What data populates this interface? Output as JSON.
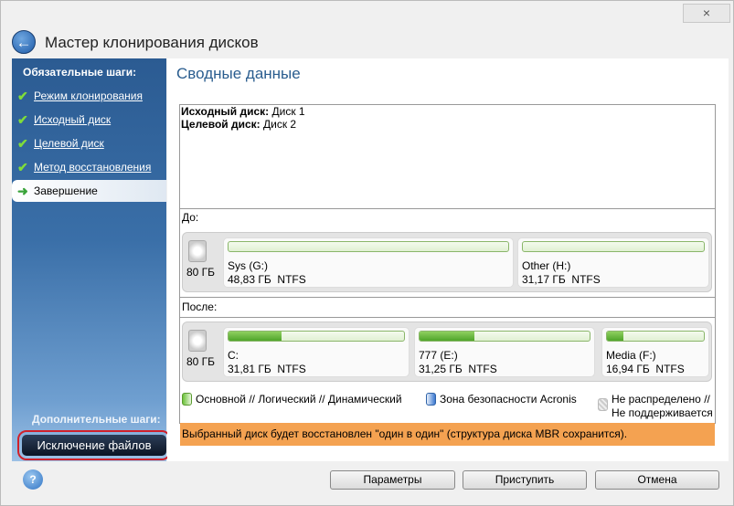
{
  "window": {
    "close_icon": "×",
    "title": "Мастер клонирования дисков"
  },
  "sidebar": {
    "required_heading": "Обязательные шаги:",
    "items": [
      {
        "label": "Режим клонирования",
        "done": true
      },
      {
        "label": "Исходный диск",
        "done": true
      },
      {
        "label": "Целевой диск",
        "done": true
      },
      {
        "label": "Метод восстановления",
        "done": true
      },
      {
        "label": "Завершение",
        "current": true
      }
    ],
    "optional_heading": "Дополнительные шаги:",
    "exclude_button": "Исключение файлов"
  },
  "main": {
    "title": "Сводные данные",
    "source_label": "Исходный диск:",
    "source_value": " Диск 1",
    "target_label": "Целевой диск:",
    "target_value": " Диск 2",
    "before_label": "До:",
    "after_label": "После:",
    "before": {
      "disk_size": "80 ГБ",
      "partitions": [
        {
          "name": "Sys (G:)",
          "size": "48,83 ГБ",
          "fs": "NTFS",
          "used_fraction": 0
        },
        {
          "name": "Other (H:)",
          "size": "31,17 ГБ",
          "fs": "NTFS",
          "used_fraction": 0
        }
      ]
    },
    "after": {
      "disk_size": "80 ГБ",
      "partitions": [
        {
          "name": "C:",
          "size": "31,81 ГБ",
          "fs": "NTFS",
          "used_fraction": 0.3
        },
        {
          "name": "777 (E:)",
          "size": "31,25 ГБ",
          "fs": "NTFS",
          "used_fraction": 0.32
        },
        {
          "name": "Media (F:)",
          "size": "16,94 ГБ",
          "fs": "NTFS",
          "used_fraction": 0.17
        }
      ]
    },
    "legend": {
      "primary": "Основной // Логический // Динамический",
      "acronis": "Зона безопасности Acronis",
      "unalloc1": "Не распределено //",
      "unalloc2": "Не поддерживается"
    },
    "notice": "Выбранный диск будет восстановлен \"один в один\" (структура диска MBR сохранится)."
  },
  "footer": {
    "help": "?",
    "params": "Параметры",
    "proceed": "Приступить",
    "cancel": "Отмена"
  }
}
